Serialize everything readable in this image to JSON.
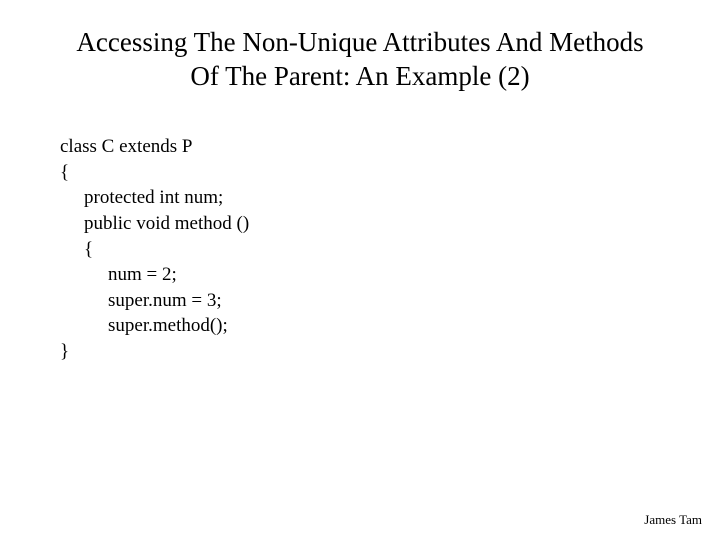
{
  "title_line1": "Accessing The Non-Unique Attributes And Methods",
  "title_line2": "Of The Parent: An Example (2)",
  "code": {
    "l0": "class C extends P",
    "l1": "{",
    "l2": "protected int num;",
    "l3": "public void method ()",
    "l4": "{",
    "l5": "num = 2;",
    "l6": "super.num = 3;",
    "l7": "super.method();",
    "l8": "}"
  },
  "footer": "James Tam"
}
